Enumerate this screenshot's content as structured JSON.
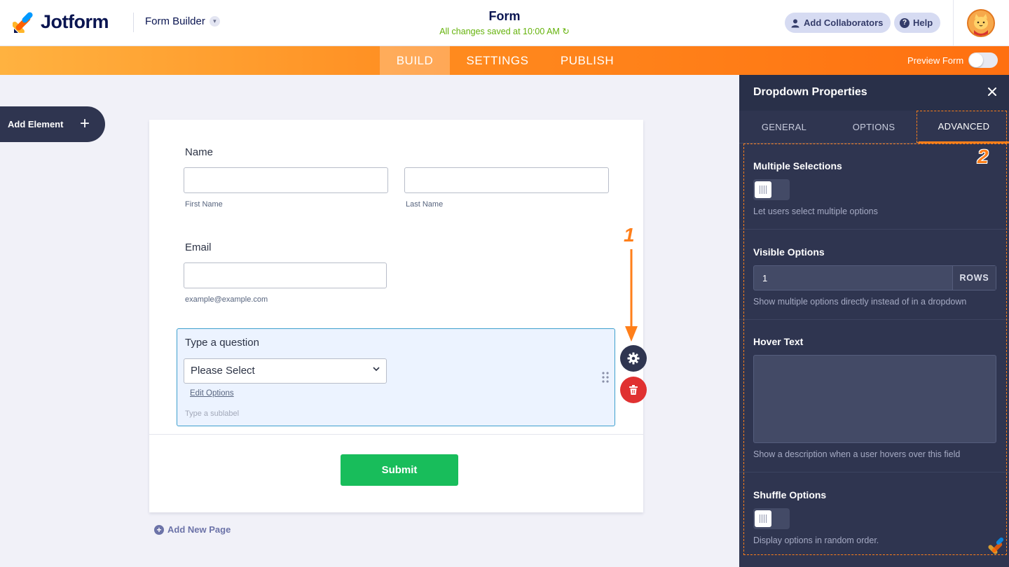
{
  "header": {
    "brand": "Jotform",
    "builder_label": "Form Builder",
    "form_title": "Form",
    "saved_status": "All changes saved at 10:00 AM",
    "collaborators_label": "Add Collaborators",
    "help_label": "Help"
  },
  "nav": {
    "tabs": [
      {
        "label": "BUILD",
        "active": true
      },
      {
        "label": "SETTINGS",
        "active": false
      },
      {
        "label": "PUBLISH",
        "active": false
      }
    ],
    "preview_label": "Preview Form"
  },
  "left": {
    "add_element_label": "Add Element"
  },
  "form": {
    "name_label": "Name",
    "first_name_sublabel": "First Name",
    "last_name_sublabel": "Last Name",
    "email_label": "Email",
    "email_sublabel": "example@example.com",
    "question_label": "Type a question",
    "dropdown_value": "Please Select",
    "edit_options_label": "Edit Options",
    "sublabel_placeholder": "Type a sublabel",
    "submit_label": "Submit",
    "add_page_label": "Add New Page"
  },
  "annotations": {
    "first": "1",
    "second": "2"
  },
  "panel": {
    "title": "Dropdown Properties",
    "tabs": [
      {
        "label": "GENERAL",
        "active": false
      },
      {
        "label": "OPTIONS",
        "active": false
      },
      {
        "label": "ADVANCED",
        "active": true
      }
    ],
    "multiple_selections": {
      "title": "Multiple Selections",
      "enabled": false,
      "description": "Let users select multiple options"
    },
    "visible_options": {
      "title": "Visible Options",
      "value": "1",
      "unit": "ROWS",
      "description": "Show multiple options directly instead of in a dropdown"
    },
    "hover_text": {
      "title": "Hover Text",
      "value": "",
      "description": "Show a description when a user hovers over this field"
    },
    "shuffle_options": {
      "title": "Shuffle Options",
      "enabled": false,
      "description": "Display options in random order."
    }
  },
  "colors": {
    "accent_orange": "#ff7f1a",
    "panel_bg": "#2f3550",
    "submit_green": "#18bd5b",
    "delete_red": "#e03131",
    "brand_navy": "#0a1551"
  }
}
